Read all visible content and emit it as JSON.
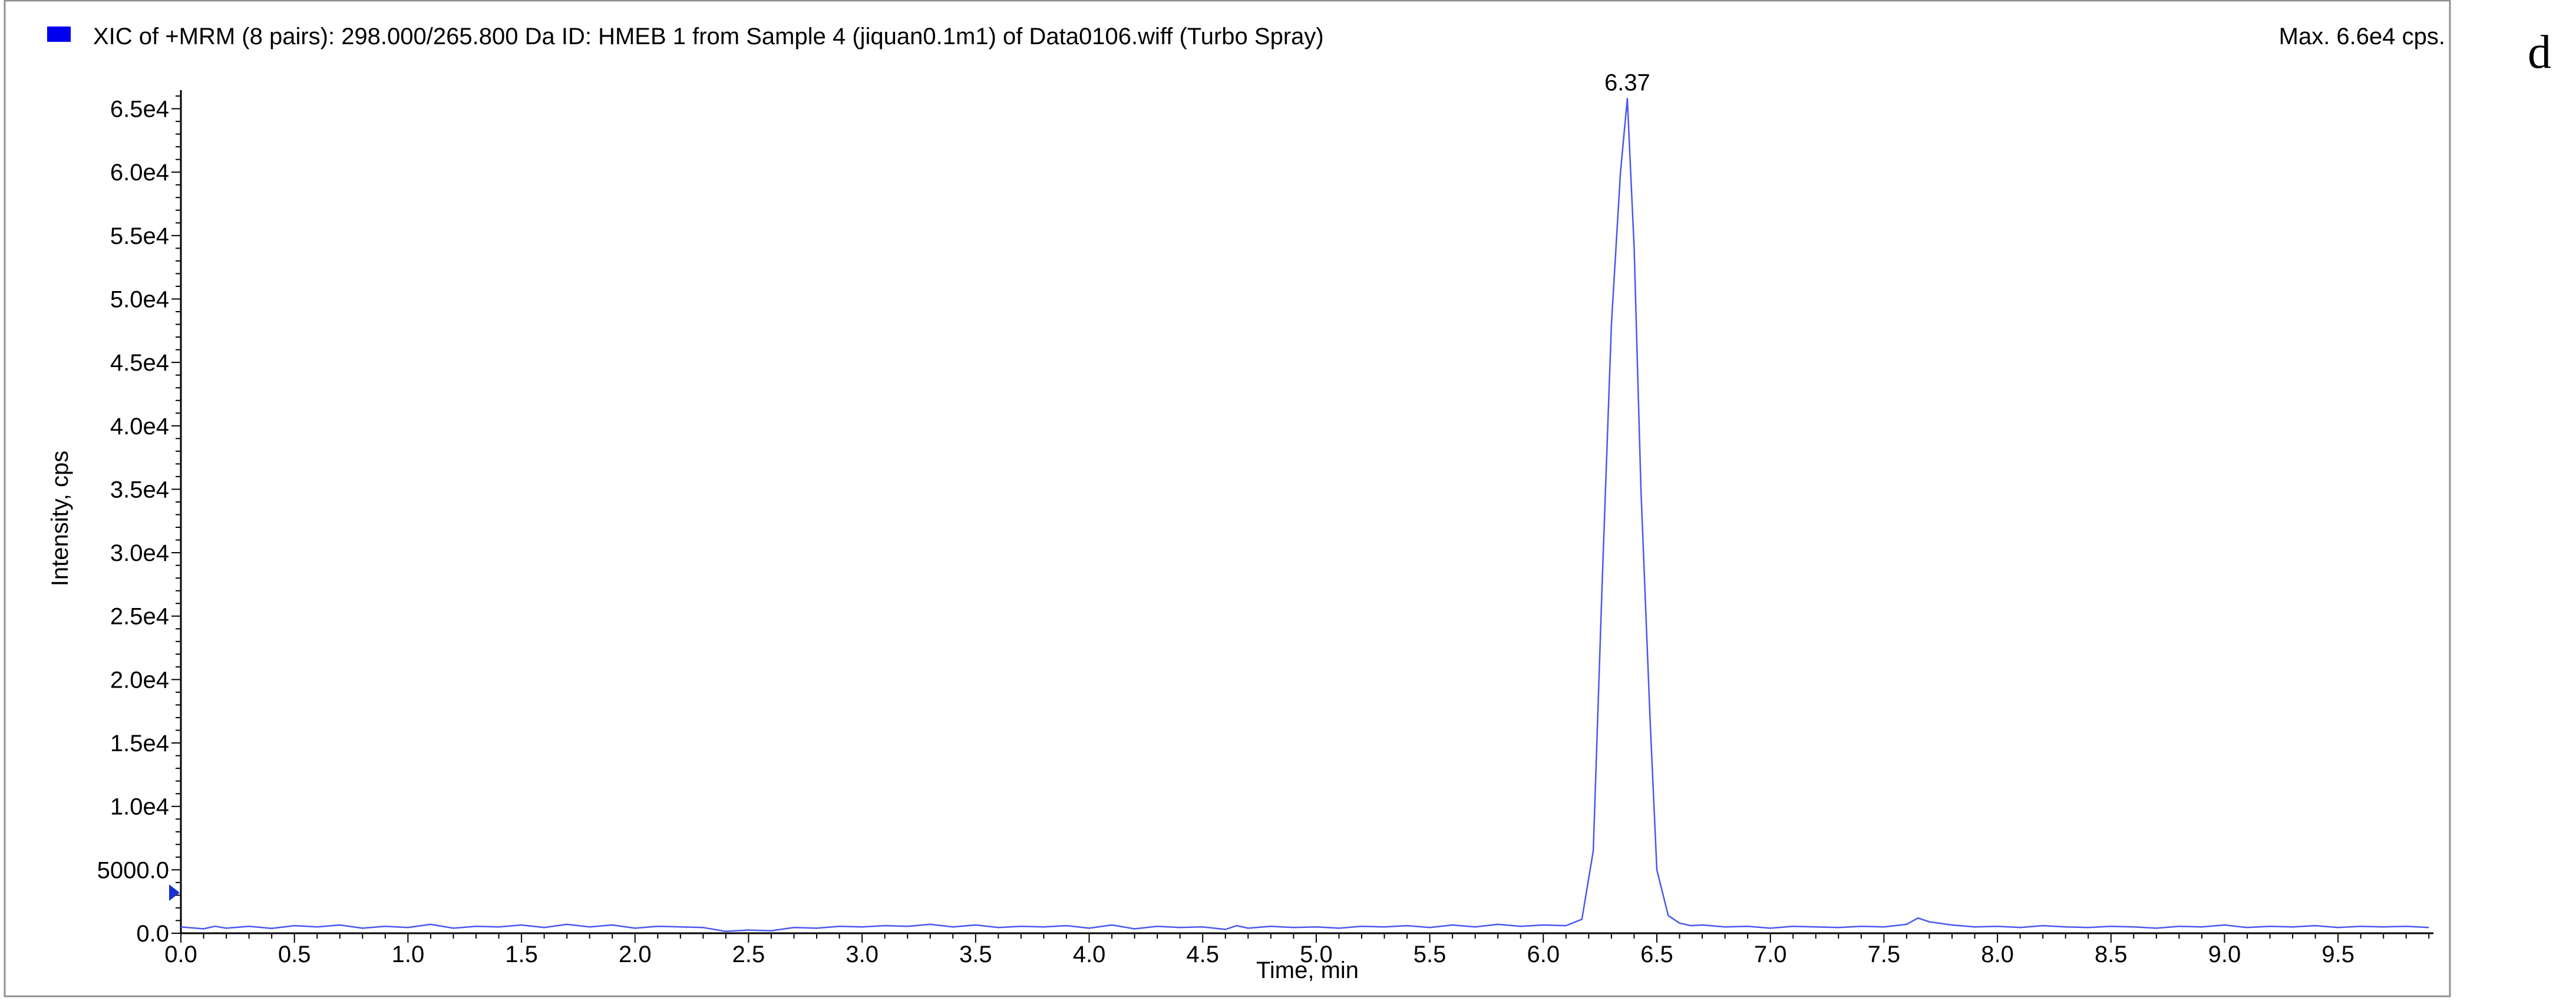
{
  "panel_letter": "d",
  "header": {
    "title": "XIC of +MRM (8 pairs): 298.000/265.800 Da ID: HMEB 1 from Sample 4 (jiquan0.1m1) of Data0106.wiff (Turbo Spray)",
    "max_label": "Max. 6.6e4 cps."
  },
  "colors": {
    "series": "#4a58f0",
    "legend_marker": "#0000ee",
    "baseline_marker": "#1530d0",
    "axis": "#000000",
    "frame": "#808080"
  },
  "chart_data": {
    "type": "line",
    "title": "XIC of +MRM (8 pairs): 298.000/265.800 Da ID: HMEB 1 from Sample 4 (jiquan0.1m1) of Data0106.wiff (Turbo Spray)",
    "xlabel": "Time, min",
    "ylabel": "Intensity, cps",
    "xlim": [
      0.0,
      9.92
    ],
    "ylim": [
      0,
      66000
    ],
    "grid": false,
    "xticks": [
      0.0,
      0.5,
      1.0,
      1.5,
      2.0,
      2.5,
      3.0,
      3.5,
      4.0,
      4.5,
      5.0,
      5.5,
      6.0,
      6.5,
      7.0,
      7.5,
      8.0,
      8.5,
      9.0,
      9.5
    ],
    "xtick_labels": [
      "0.0",
      "0.5",
      "1.0",
      "1.5",
      "2.0",
      "2.5",
      "3.0",
      "3.5",
      "4.0",
      "4.5",
      "5.0",
      "5.5",
      "6.0",
      "6.5",
      "7.0",
      "7.5",
      "8.0",
      "8.5",
      "9.0",
      "9.5"
    ],
    "yticks": [
      0,
      5000,
      10000,
      15000,
      20000,
      25000,
      30000,
      35000,
      40000,
      45000,
      50000,
      55000,
      60000,
      65000
    ],
    "ytick_labels": [
      "0.0",
      "5000.0",
      "1.0e4",
      "1.5e4",
      "2.0e4",
      "2.5e4",
      "3.0e4",
      "3.5e4",
      "4.0e4",
      "4.5e4",
      "5.0e4",
      "5.5e4",
      "6.0e4",
      "6.5e4"
    ],
    "peak_annotation": {
      "x": 6.37,
      "y": 65800,
      "label": "6.37"
    },
    "baseline_marker_y": 3200,
    "series": [
      {
        "x": [
          0.0,
          0.1,
          0.15,
          0.2,
          0.3,
          0.4,
          0.5,
          0.6,
          0.7,
          0.8,
          0.9,
          1.0,
          1.1,
          1.2,
          1.3,
          1.4,
          1.5,
          1.6,
          1.7,
          1.8,
          1.9,
          2.0,
          2.1,
          2.2,
          2.3,
          2.4,
          2.5,
          2.6,
          2.7,
          2.8,
          2.9,
          3.0,
          3.1,
          3.2,
          3.3,
          3.4,
          3.5,
          3.6,
          3.7,
          3.8,
          3.9,
          4.0,
          4.1,
          4.2,
          4.3,
          4.4,
          4.5,
          4.6,
          4.65,
          4.7,
          4.8,
          4.9,
          5.0,
          5.1,
          5.2,
          5.3,
          5.4,
          5.5,
          5.6,
          5.7,
          5.8,
          5.9,
          6.0,
          6.1,
          6.17,
          6.22,
          6.26,
          6.3,
          6.34,
          6.37,
          6.4,
          6.43,
          6.47,
          6.5,
          6.55,
          6.6,
          6.65,
          6.7,
          6.8,
          6.9,
          7.0,
          7.1,
          7.2,
          7.3,
          7.4,
          7.5,
          7.6,
          7.65,
          7.7,
          7.8,
          7.9,
          8.0,
          8.1,
          8.2,
          8.3,
          8.4,
          8.5,
          8.6,
          8.7,
          8.8,
          8.9,
          9.0,
          9.1,
          9.2,
          9.3,
          9.4,
          9.5,
          9.6,
          9.7,
          9.8,
          9.9
        ],
        "y": [
          500,
          350,
          550,
          400,
          550,
          380,
          600,
          500,
          650,
          400,
          550,
          450,
          700,
          400,
          550,
          500,
          650,
          450,
          700,
          500,
          650,
          400,
          550,
          500,
          450,
          150,
          250,
          200,
          450,
          400,
          550,
          500,
          600,
          550,
          700,
          500,
          650,
          450,
          550,
          500,
          600,
          400,
          650,
          350,
          550,
          450,
          500,
          300,
          600,
          400,
          550,
          450,
          500,
          400,
          550,
          500,
          600,
          450,
          650,
          500,
          700,
          550,
          650,
          600,
          1100,
          6500,
          28000,
          48000,
          60000,
          65800,
          54000,
          35000,
          17000,
          5000,
          1400,
          800,
          600,
          650,
          500,
          550,
          400,
          550,
          500,
          450,
          550,
          500,
          700,
          1200,
          900,
          650,
          500,
          550,
          450,
          600,
          500,
          450,
          550,
          500,
          400,
          550,
          500,
          650,
          450,
          550,
          500,
          600,
          450,
          550,
          500,
          550,
          450
        ]
      }
    ]
  }
}
